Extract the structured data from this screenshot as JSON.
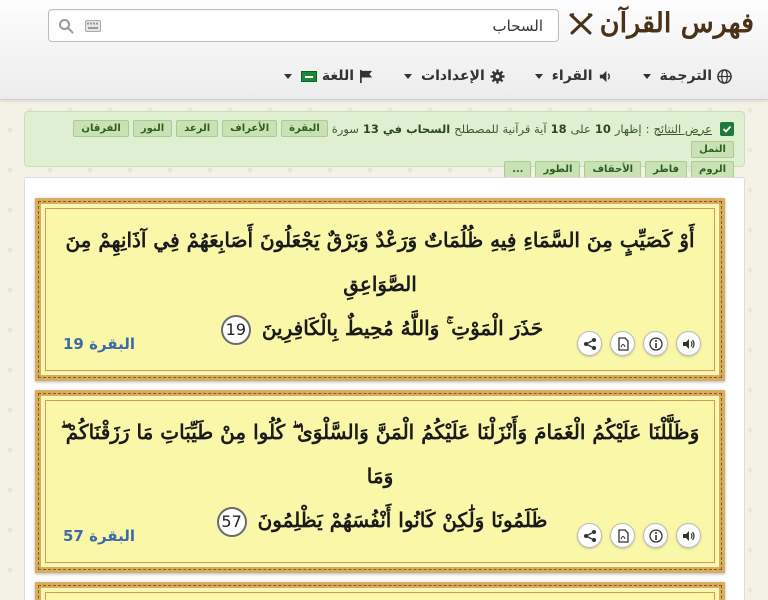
{
  "app": {
    "title": "فهرس القرآن"
  },
  "search": {
    "value": "السحاب",
    "placeholder": ""
  },
  "menu": {
    "translation": "الترجمة",
    "reciters": "القراء",
    "settings": "الإعدادات",
    "language": "اللغة"
  },
  "alert": {
    "prefix": "عرض النتائج",
    "sep": ":",
    "t1": "إظهار",
    "from": "10",
    "t2": "على",
    "total": "18",
    "t3": "آية قرآنية للمصطلح",
    "term": "السحاب",
    "t4": "في",
    "surah_count": "13",
    "t5": "سورة",
    "tags_row1": [
      "البقرة",
      "الأعراف",
      "الرعد",
      "النور",
      "الفرقان",
      "النمل"
    ],
    "tags_row2": [
      "الروم",
      "فاطر",
      "الأحقاف",
      "الطور",
      "..."
    ]
  },
  "results": [
    {
      "line1": "أَوْ كَصَيِّبٍ مِنَ السَّمَاءِ فِيهِ ظُلُمَاتٌ وَرَعْدٌ وَبَرْقٌ يَجْعَلُونَ أَصَابِعَهُمْ فِي آذَانِهِمْ مِنَ الصَّوَاعِقِ",
      "line2": "حَذَرَ الْمَوْتِ ۚ وَاللَّهُ مُحِيطٌ بِالْكَافِرِينَ",
      "ayah": "19",
      "reference": "البقرة 19"
    },
    {
      "line1": "وَظَلَّلْنَا عَلَيْكُمُ الْغَمَامَ وَأَنْزَلْنَا عَلَيْكُمُ الْمَنَّ وَالسَّلْوَىٰ ۖ كُلُوا مِنْ طَيِّبَاتِ مَا رَزَقْنَاكُمْ ۖ وَمَا",
      "line2": "ظَلَمُونَا وَلَٰكِنْ كَانُوا أَنْفُسَهُمْ يَظْلِمُونَ",
      "ayah": "57",
      "reference": "البقرة 57"
    }
  ],
  "colors": {
    "card_bg": "#fbf7a8",
    "card_border": "#d8ad5b",
    "reference": "#3d6ca8",
    "alert_bg": "#dff0d2"
  },
  "icons": [
    "search-icon",
    "keyboard-icon",
    "globe-icon",
    "speaker-icon",
    "gear-icon",
    "flag-icon",
    "check-icon",
    "share-icon",
    "pdf-icon",
    "info-icon",
    "audio-icon"
  ]
}
